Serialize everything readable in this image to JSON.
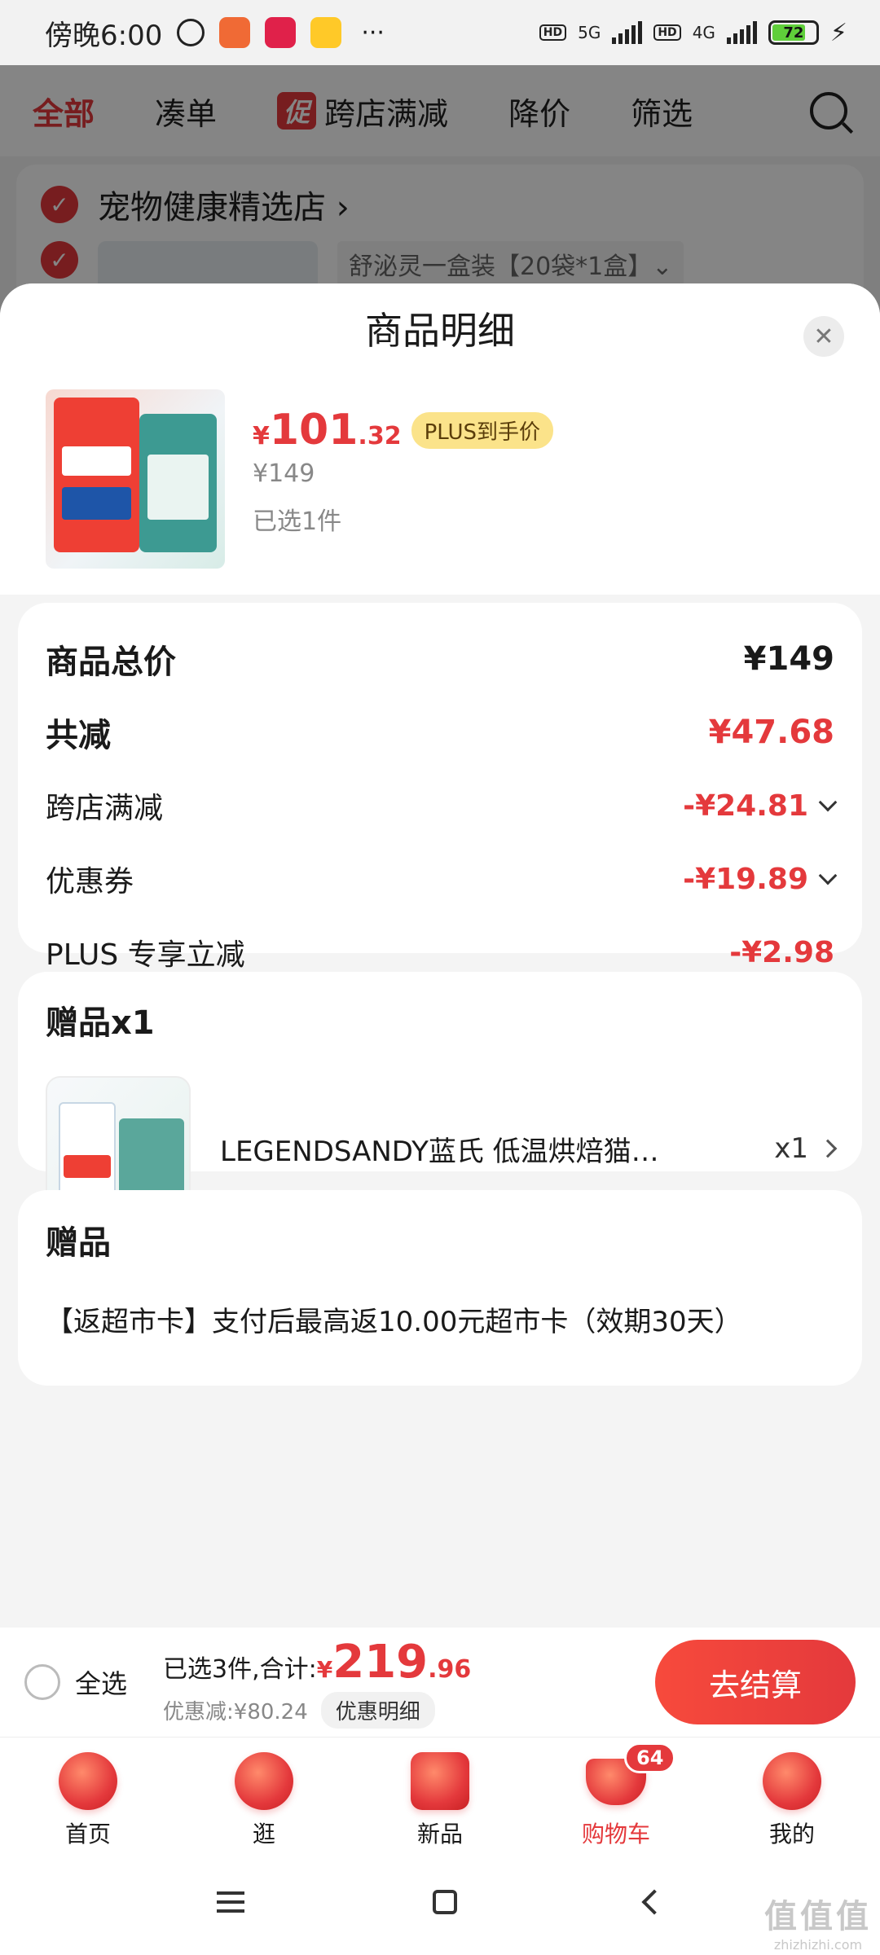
{
  "status_bar": {
    "time": "傍晚6:00",
    "more": "···",
    "net1": "5G",
    "net2": "4G",
    "hd": "HD",
    "battery": "72"
  },
  "background": {
    "tabs": [
      "全部",
      "凑单",
      "跨店满减",
      "降价",
      "筛选"
    ],
    "promo_badge": "促",
    "store_name": "宠物健康精选店 ›",
    "spec": "舒泌灵一盒装【20袋*1盒】⌄"
  },
  "sheet": {
    "title": "商品明细",
    "close": "✕"
  },
  "product": {
    "price_currency": "¥",
    "price_int": "101",
    "price_dec": ".32",
    "plus_tag": "PLUS到手价",
    "original_price": "¥149",
    "selected": "已选1件"
  },
  "price_breakdown": {
    "total_label": "商品总价",
    "total_value": "¥149",
    "reduce_label": "共减",
    "reduce_value": "¥47.68",
    "cross_label": "跨店满减",
    "cross_value": "-¥24.81",
    "coupon_label": "优惠券",
    "coupon_value": "-¥19.89",
    "plus_label": "PLUS 专享立减",
    "plus_value": "-¥2.98"
  },
  "gift_item": {
    "title": "赠品x1",
    "name": "LEGENDSANDY蓝氏 低温烘焙猫…",
    "qty": "x1"
  },
  "gift_card": {
    "title": "赠品",
    "desc": "【返超市卡】支付后最高返10.00元超市卡（效期30天）"
  },
  "checkout": {
    "select_all": "全选",
    "summary_prefix": "已选3件,合计:",
    "currency": "¥",
    "total_int": "219",
    "total_dec": ".96",
    "discount": "优惠减:¥80.24",
    "detail": "优惠明细",
    "button": "去结算"
  },
  "tabbar": {
    "items": [
      "首页",
      "逛",
      "新品",
      "购物车",
      "我的"
    ],
    "cart_badge": "64"
  },
  "watermark": {
    "big": "值值值",
    "small": "zhizhizhi.com"
  },
  "colors": {
    "accent": "#e4393c",
    "plus_tag": "#fbe38a"
  }
}
